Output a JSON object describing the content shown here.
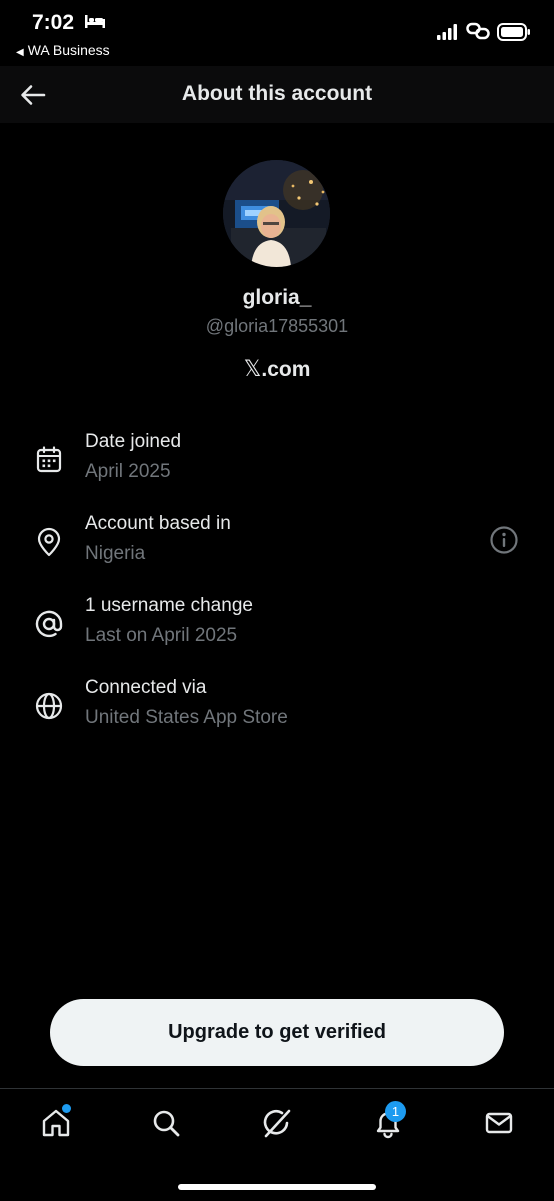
{
  "status_bar": {
    "time": "7:02",
    "back_app": "WA Business"
  },
  "header": {
    "title": "About this account"
  },
  "profile": {
    "display_name": "gloria_",
    "handle": "@gloria17855301",
    "site": ".com",
    "site_glyph": "𝕏"
  },
  "info": [
    {
      "icon": "calendar-icon",
      "title": "Date joined",
      "value": "April 2025"
    },
    {
      "icon": "location-pin-icon",
      "title": "Account based in",
      "value": "Nigeria"
    },
    {
      "icon": "at-sign-icon",
      "title": "1 username change",
      "value": "Last on April 2025"
    },
    {
      "icon": "globe-icon",
      "title": "Connected via",
      "value": "United States App Store"
    }
  ],
  "upgrade": {
    "label": "Upgrade to get verified"
  },
  "tab_bar": {
    "notifications_badge": "1",
    "tabs": [
      "home-icon",
      "search-icon",
      "grok-icon",
      "bell-icon",
      "mail-icon"
    ]
  },
  "colors": {
    "background": "#000000",
    "primary_text": "#e7e9ea",
    "secondary_text": "#71767b",
    "accent": "#1d9bf0",
    "button_bg": "#eff3f4"
  }
}
